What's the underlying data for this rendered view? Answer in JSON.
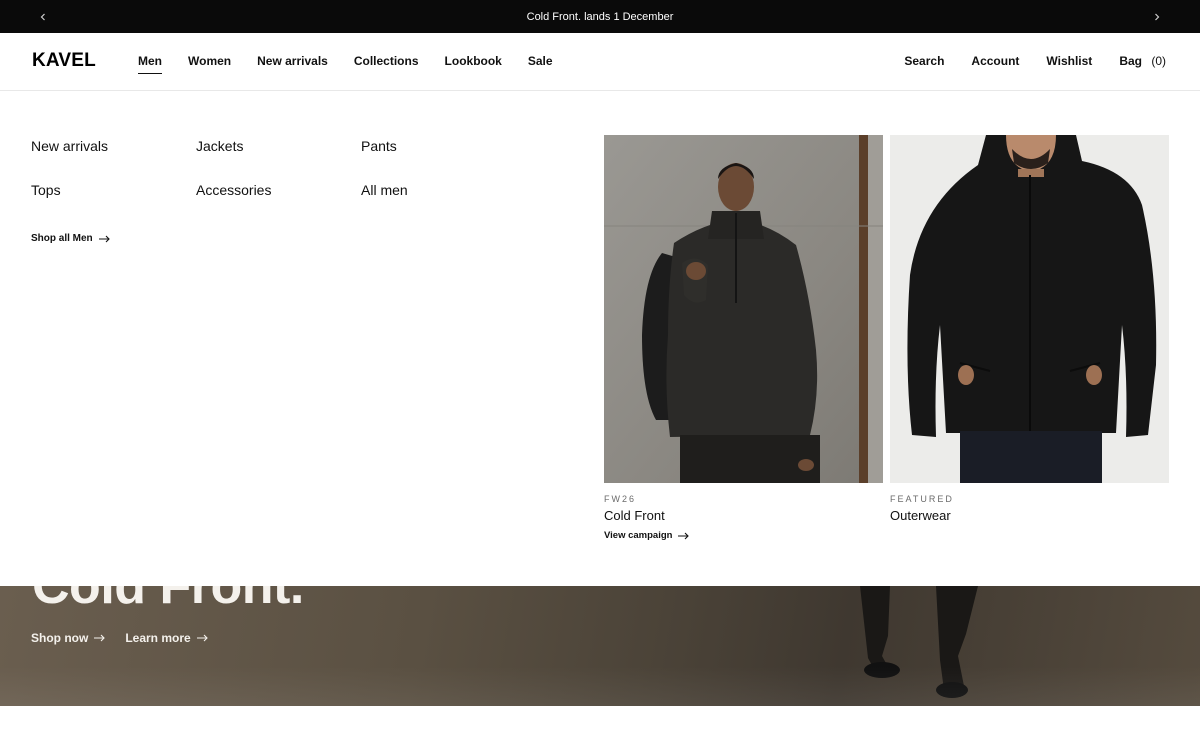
{
  "announcement": {
    "text": "Cold Front. lands 1 December"
  },
  "header": {
    "logo": "KAVEL",
    "nav": [
      {
        "label": "Men",
        "active": true
      },
      {
        "label": "Women"
      },
      {
        "label": "New arrivals"
      },
      {
        "label": "Collections"
      },
      {
        "label": "Lookbook"
      },
      {
        "label": "Sale"
      }
    ],
    "utility": {
      "search": "Search",
      "account": "Account",
      "wishlist": "Wishlist",
      "bag": "Bag",
      "bag_count": "(0)"
    }
  },
  "mega_menu": {
    "columns": [
      [
        "New arrivals",
        "Tops"
      ],
      [
        "Jackets",
        "Accessories"
      ],
      [
        "Pants",
        "All men"
      ]
    ],
    "shop_all": "Shop all Men",
    "cards": [
      {
        "eyebrow": "FW26",
        "title": "Cold Front",
        "link": "View campaign"
      },
      {
        "eyebrow": "FEATURED",
        "title": "Outerwear"
      }
    ]
  },
  "hero": {
    "title": "Cold Front.",
    "links": [
      "Shop now",
      "Learn more"
    ]
  },
  "colors": {
    "announcement_bg": "#0a0a0a",
    "text": "#111111",
    "hero_text": "#f4f1ec",
    "eyebrow": "#6b6b6b"
  }
}
